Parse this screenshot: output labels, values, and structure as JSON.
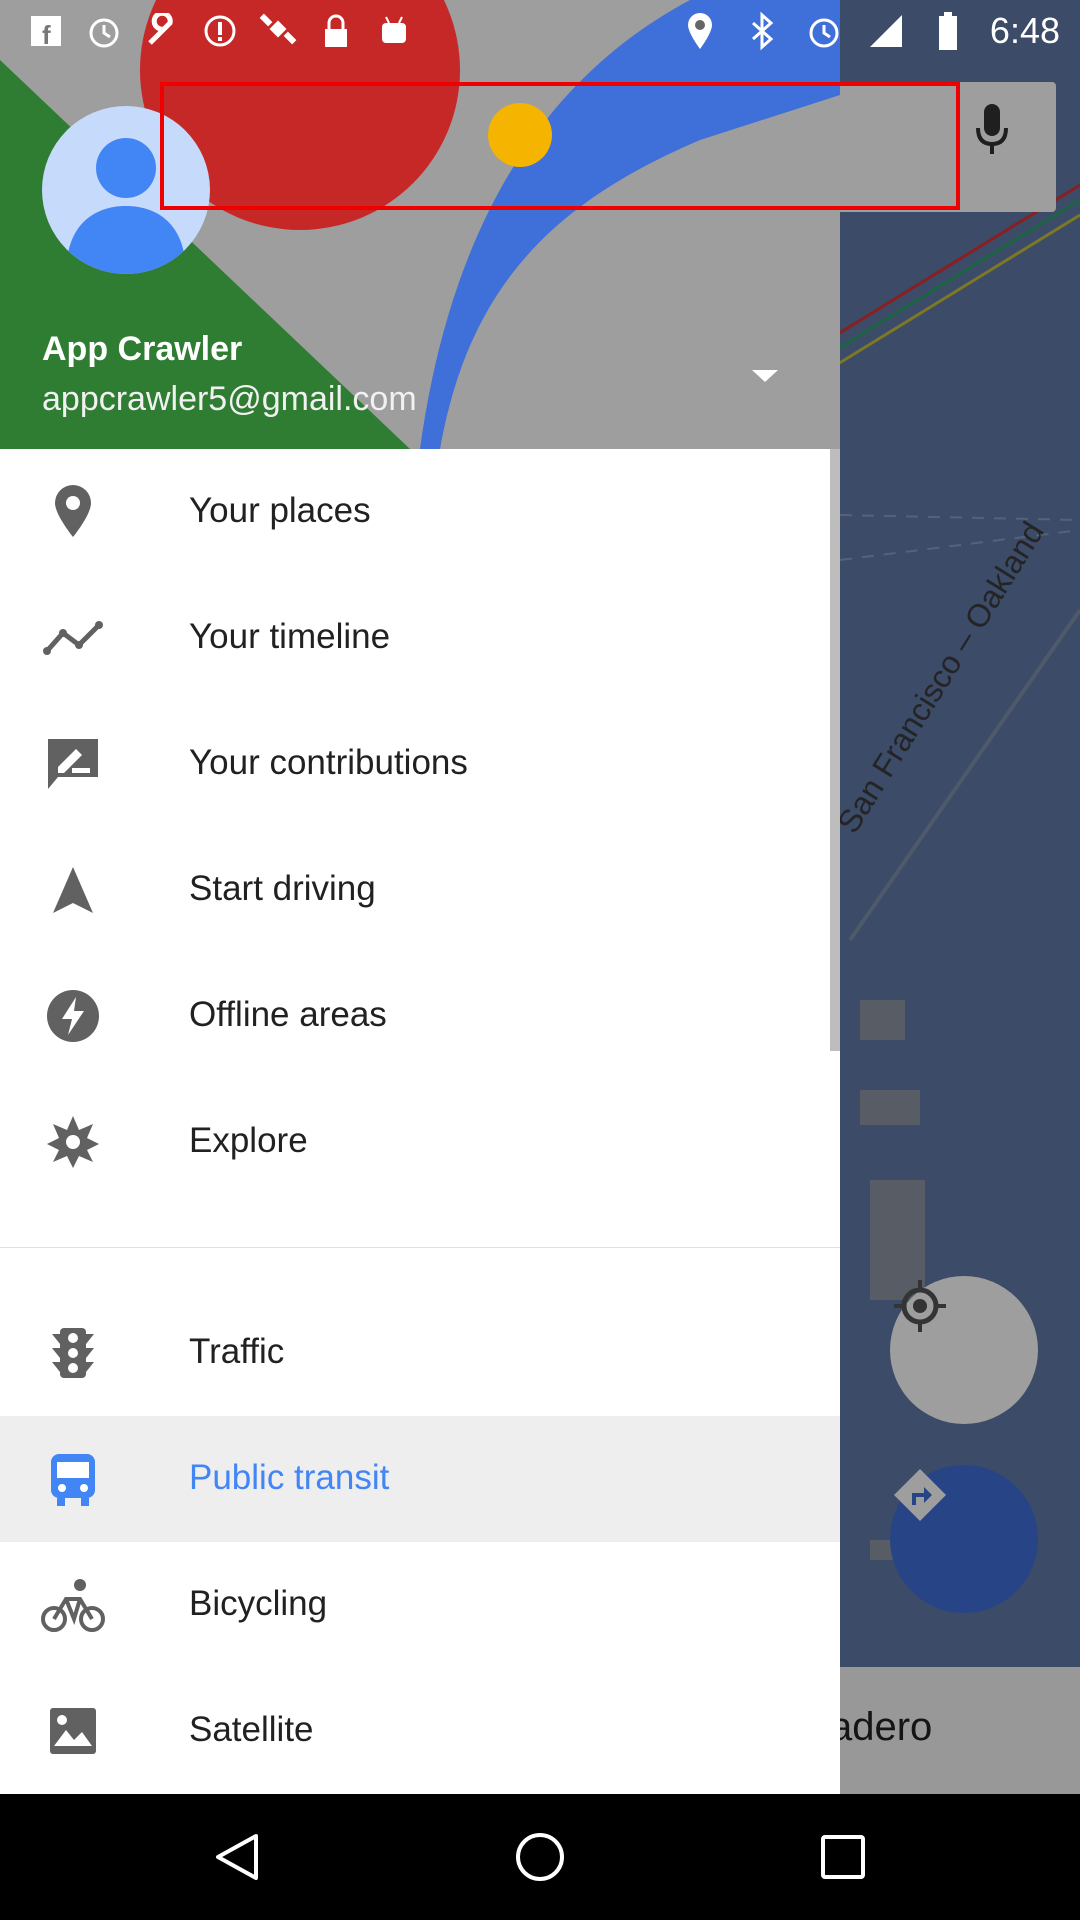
{
  "status_bar": {
    "time": "6:48",
    "left_icons": [
      "facebook-icon",
      "alarm-icon",
      "wrench-icon",
      "info-icon",
      "satellite-icon",
      "lock-icon",
      "android-icon"
    ],
    "right_icons": [
      "location-icon",
      "bluetooth-icon",
      "alarm-icon",
      "signal-icon",
      "battery-icon"
    ]
  },
  "map": {
    "route_label": "San Francisco – Oakland",
    "bottom_sheet_text": "adero"
  },
  "drawer": {
    "user_name": "App Crawler",
    "user_email": "appcrawler5@gmail.com",
    "section1": [
      {
        "label": "Your places",
        "icon": "place-pin-icon"
      },
      {
        "label": "Your timeline",
        "icon": "timeline-icon"
      },
      {
        "label": "Your contributions",
        "icon": "contributions-icon"
      },
      {
        "label": "Start driving",
        "icon": "navigation-arrow-icon"
      },
      {
        "label": "Offline areas",
        "icon": "offline-bolt-icon"
      },
      {
        "label": "Explore",
        "icon": "explore-star-icon"
      }
    ],
    "section2": [
      {
        "label": "Traffic",
        "icon": "traffic-light-icon",
        "active": false
      },
      {
        "label": "Public transit",
        "icon": "transit-bus-icon",
        "active": true
      },
      {
        "label": "Bicycling",
        "icon": "bicycle-icon",
        "active": false
      },
      {
        "label": "Satellite",
        "icon": "satellite-image-icon",
        "active": false
      }
    ]
  },
  "colors": {
    "accent": "#4285f4",
    "header_green": "#2e7d32",
    "header_red": "#c62828",
    "header_blue": "#3f6fd8",
    "highlight": "#ee0000"
  }
}
